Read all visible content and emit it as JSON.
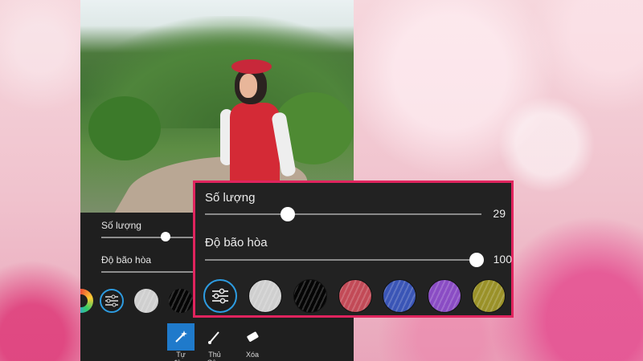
{
  "photo": {
    "description_icon": "portrait-photo"
  },
  "small_panel": {
    "slider1_label": "Số lượng",
    "slider2_label": "Độ bão hòa",
    "slider1_value_fraction": 0.29,
    "tools": [
      {
        "label": "Tự động",
        "icon": "magic-wand-icon",
        "active": true
      },
      {
        "label": "Thủ Cô...",
        "icon": "brush-icon",
        "active": false
      },
      {
        "label": "Xóa",
        "icon": "eraser-icon",
        "active": false
      }
    ]
  },
  "zoom_panel": {
    "slider1": {
      "label": "Số lượng",
      "value": "29"
    },
    "slider2": {
      "label": "Độ bão hòa",
      "value": "100"
    },
    "swatches": [
      {
        "name": "adjust",
        "color": "#1d1d1d"
      },
      {
        "name": "silver",
        "color": "#cfcfcf"
      },
      {
        "name": "black",
        "color": "#050505"
      },
      {
        "name": "red",
        "color": "#c24a57"
      },
      {
        "name": "blue",
        "color": "#3a55b6"
      },
      {
        "name": "purple",
        "color": "#8a4cc4"
      },
      {
        "name": "olive",
        "color": "#9a9128"
      }
    ]
  },
  "colors": {
    "accent": "#2d9be0",
    "highlight_border": "#e0245e",
    "active_tool": "#1f7acb"
  }
}
